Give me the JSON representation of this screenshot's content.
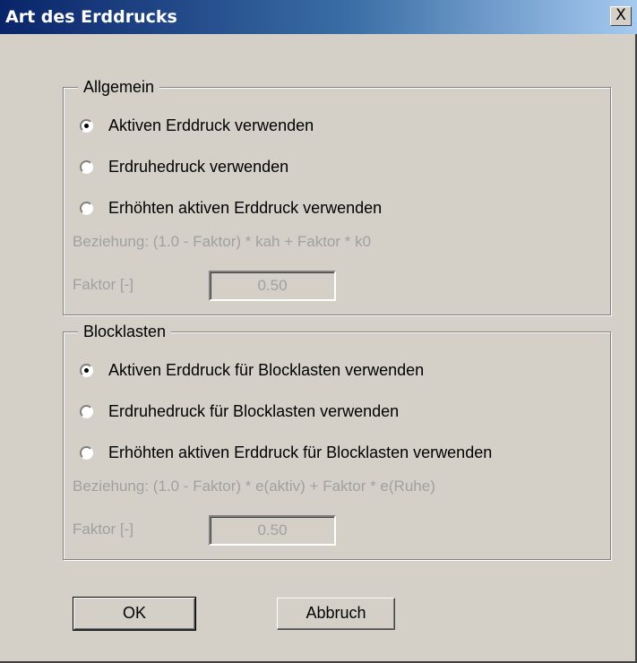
{
  "window": {
    "title": "Art des Erddrucks",
    "close_label": "X"
  },
  "allgemein": {
    "legend": "Allgemein",
    "options": [
      {
        "label": "Aktiven Erddruck verwenden",
        "checked": true
      },
      {
        "label": "Erdruhedruck verwenden",
        "checked": false
      },
      {
        "label": "Erhöhten aktiven Erddruck verwenden",
        "checked": false
      }
    ],
    "relation": "Beziehung:  (1.0 - Faktor) * kah + Faktor * k0",
    "factor_label": "Faktor [-]",
    "factor_value": "0.50"
  },
  "blocklasten": {
    "legend": "Blocklasten",
    "options": [
      {
        "label": "Aktiven Erddruck für Blocklasten verwenden",
        "checked": true
      },
      {
        "label": "Erdruhedruck für Blocklasten verwenden",
        "checked": false
      },
      {
        "label": "Erhöhten aktiven Erddruck für Blocklasten verwenden",
        "checked": false
      }
    ],
    "relation": "Beziehung:  (1.0 - Faktor) * e(aktiv) + Faktor * e(Ruhe)",
    "factor_label": "Faktor [-]",
    "factor_value": "0.50"
  },
  "buttons": {
    "ok": "OK",
    "cancel": "Abbruch"
  }
}
